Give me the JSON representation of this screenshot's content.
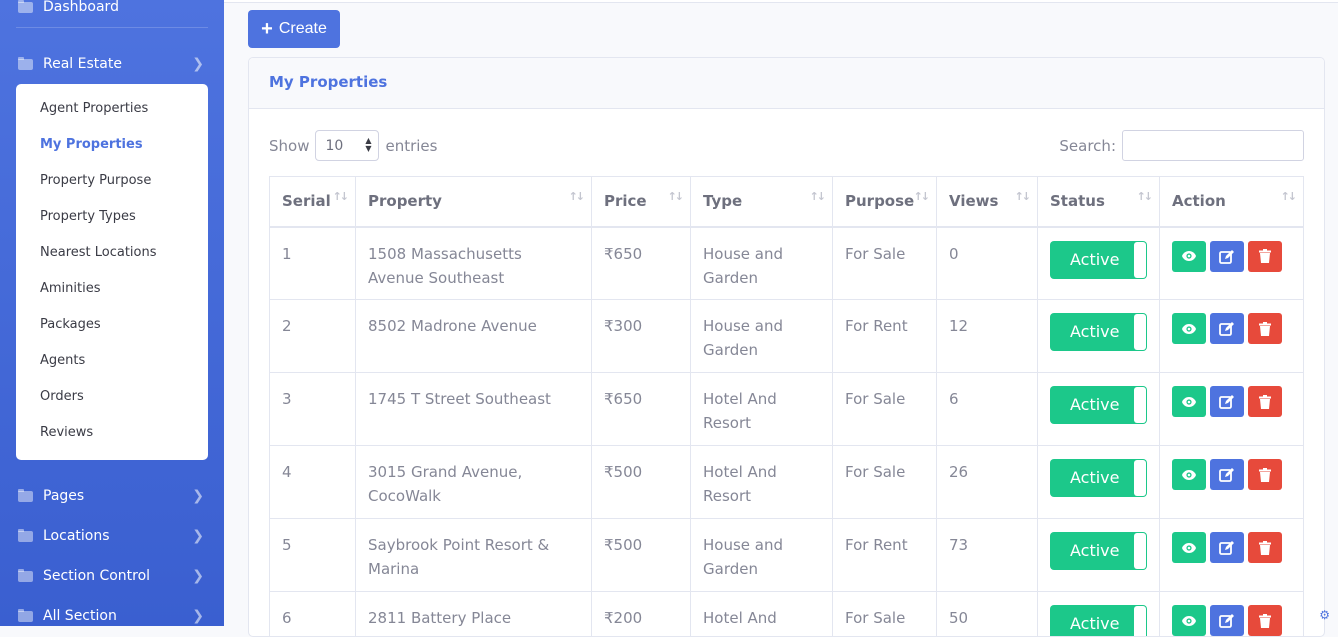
{
  "sidebar": {
    "dashboard": "Dashboard",
    "real_estate": "Real Estate",
    "submenu": [
      "Agent Properties",
      "My Properties",
      "Property Purpose",
      "Property Types",
      "Nearest Locations",
      "Aminities",
      "Packages",
      "Agents",
      "Orders",
      "Reviews"
    ],
    "active_submenu": "My Properties",
    "pages": "Pages",
    "locations": "Locations",
    "section_control": "Section Control",
    "all_section": "All Section"
  },
  "toolbar": {
    "create_label": "Create"
  },
  "card": {
    "title": "My Properties"
  },
  "table_controls": {
    "show_label": "Show",
    "entries_value": "10",
    "entries_label": "entries",
    "search_label": "Search:",
    "search_value": ""
  },
  "table": {
    "columns": [
      "Serial",
      "Property",
      "Price",
      "Type",
      "Purpose",
      "Views",
      "Status",
      "Action"
    ],
    "rows": [
      {
        "serial": "1",
        "property": "1508 Massachusetts Avenue Southeast",
        "price": "₹650",
        "type": "House and Garden",
        "purpose": "For Sale",
        "views": "0",
        "status": "Active"
      },
      {
        "serial": "2",
        "property": "8502 Madrone Avenue",
        "price": "₹300",
        "type": "House and Garden",
        "purpose": "For Rent",
        "views": "12",
        "status": "Active"
      },
      {
        "serial": "3",
        "property": "1745 T Street Southeast",
        "price": "₹650",
        "type": "Hotel And Resort",
        "purpose": "For Sale",
        "views": "6",
        "status": "Active"
      },
      {
        "serial": "4",
        "property": "3015 Grand Avenue, CocoWalk",
        "price": "₹500",
        "type": "Hotel And Resort",
        "purpose": "For Sale",
        "views": "26",
        "status": "Active"
      },
      {
        "serial": "5",
        "property": "Saybrook Point Resort & Marina",
        "price": "₹500",
        "type": "House and Garden",
        "purpose": "For Rent",
        "views": "73",
        "status": "Active"
      },
      {
        "serial": "6",
        "property": "2811 Battery Place",
        "price": "₹200",
        "type": "Hotel And",
        "purpose": "For Sale",
        "views": "50",
        "status": "Active"
      }
    ]
  },
  "colors": {
    "primary": "#4e73df",
    "success": "#1cc88a",
    "danger": "#e74a3b"
  },
  "icons": {
    "view": "eye-icon",
    "edit": "edit-icon",
    "delete": "trash-icon",
    "folder": "folder-icon",
    "chevron": "chevron-right-icon"
  }
}
